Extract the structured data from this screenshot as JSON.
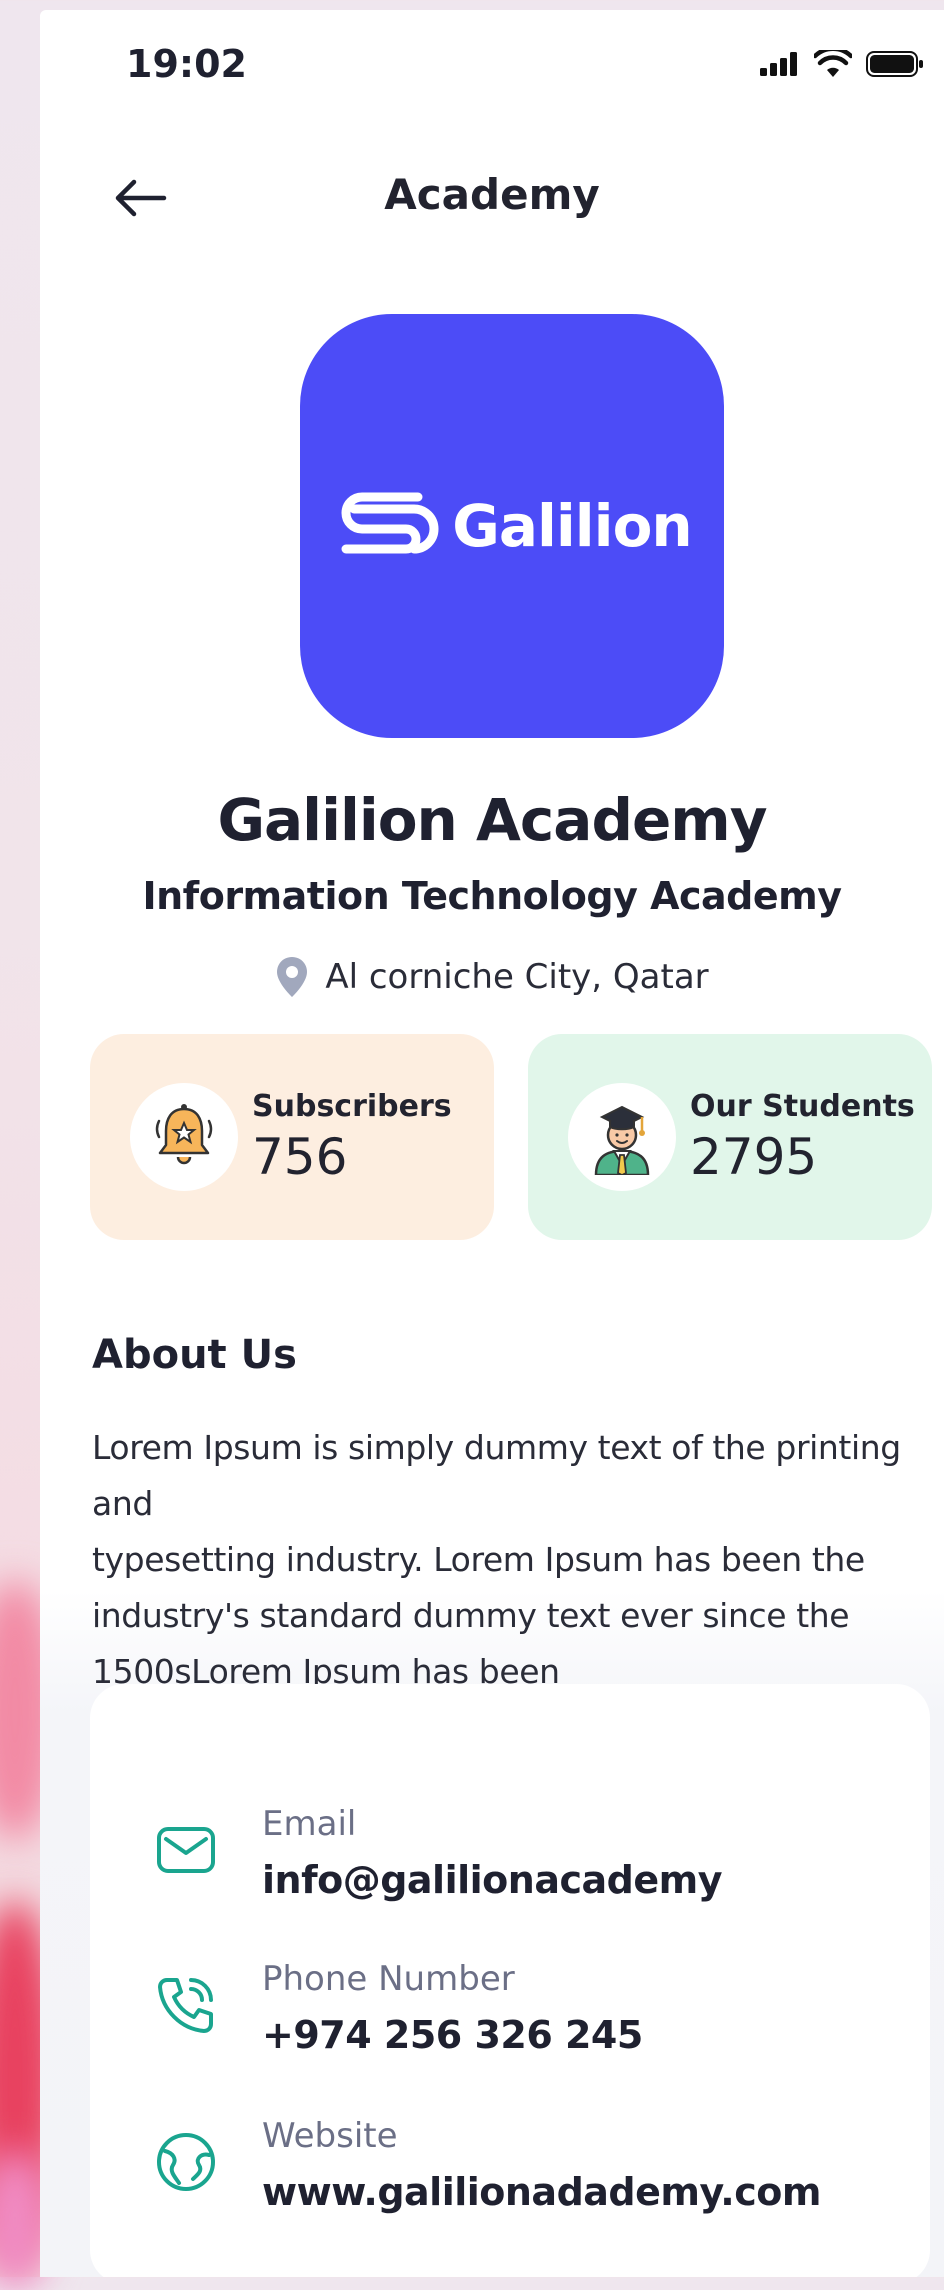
{
  "status_bar": {
    "time": "19:02"
  },
  "nav": {
    "title": "Academy"
  },
  "logo": {
    "word": "Galilion",
    "color": "#4c4cf7"
  },
  "academy": {
    "name": "Galilion Academy",
    "type": "Information Technology Academy",
    "location": "Al corniche City, Qatar"
  },
  "stats": {
    "subscribers": {
      "label": "Subscribers",
      "value": "756",
      "bg": "#fdeee0",
      "icon": "bell-star-icon"
    },
    "students": {
      "label": "Our Students",
      "value": "2795",
      "bg": "#e1f6ea",
      "icon": "graduate-icon"
    }
  },
  "about": {
    "title": "About Us",
    "lines": [
      "Lorem Ipsum is simply dummy text of the printing and",
      "typesetting industry. Lorem Ipsum has been the",
      "industry's standard dummy text ever since the",
      "1500sLorem Ipsum has been"
    ]
  },
  "contacts": [
    {
      "label": "Email",
      "value": "info@galilionacademy",
      "icon": "mail-icon"
    },
    {
      "label": "Phone Number",
      "value": "+974 256 326 245",
      "icon": "phone-icon"
    },
    {
      "label": "Website",
      "value": "www.galilionadademy.com",
      "icon": "globe-icon"
    }
  ],
  "accent": "#1aa58f"
}
